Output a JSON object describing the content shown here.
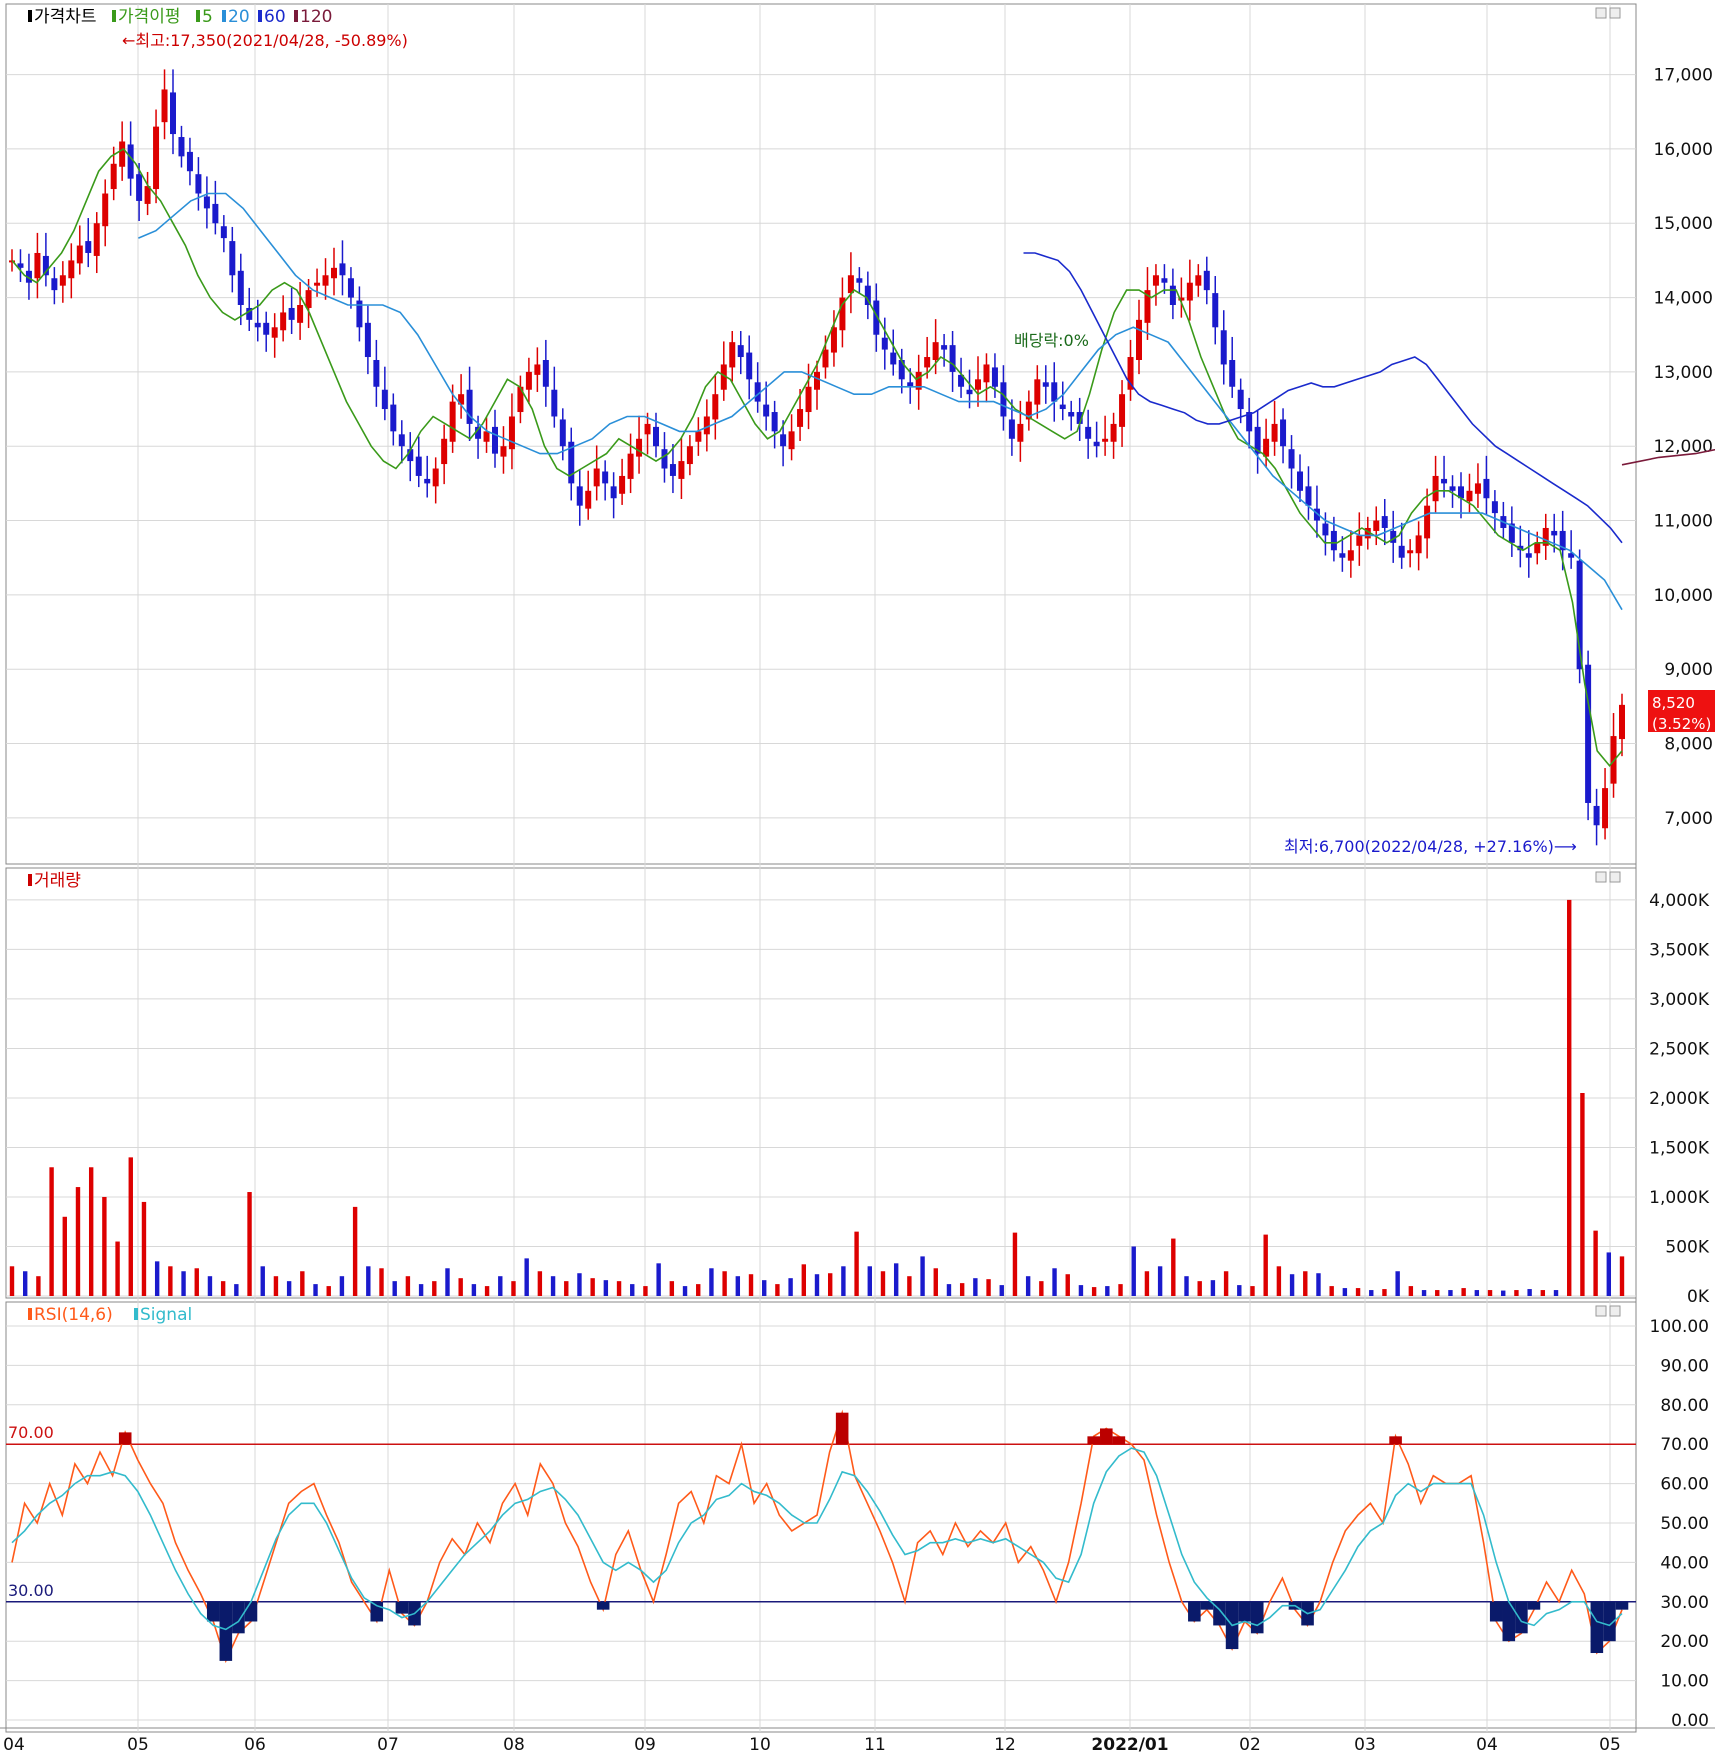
{
  "chart_data": [
    {
      "type": "candlestick",
      "panel": "price",
      "legend": [
        {
          "text": "가격차트",
          "color": "#000000"
        },
        {
          "text": "가격이평",
          "color": "#3a9a1a"
        },
        {
          "text": "5",
          "color": "#3a9a1a"
        },
        {
          "text": "20",
          "color": "#2a8fd8"
        },
        {
          "text": "60",
          "color": "#1a2acc"
        },
        {
          "text": "120",
          "color": "#7a1a3a"
        }
      ],
      "ylim": [
        6500,
        17600
      ],
      "yticks": [
        7000,
        8000,
        9000,
        10000,
        11000,
        12000,
        13000,
        14000,
        15000,
        16000,
        17000
      ],
      "ytick_labels": [
        "7,000",
        "8,000",
        "9,000",
        "10,000",
        "11,000",
        "12,000",
        "13,000",
        "14,000",
        "15,000",
        "16,000",
        "17,000"
      ],
      "annotations": {
        "high": "←최고:17,350(2021/04/28, -50.89%)",
        "low": "최저:6,700(2022/04/28, +27.16%)⟶",
        "dividend": "배당락:0%"
      },
      "last_price_label": "8,520",
      "last_change_label": "(3.52%)",
      "close_series": [
        14500,
        14400,
        14200,
        14600,
        14300,
        14100,
        14300,
        14500,
        14700,
        14600,
        15000,
        15400,
        15800,
        16100,
        15600,
        15300,
        15500,
        16300,
        16800,
        16200,
        15900,
        15700,
        15400,
        15200,
        15000,
        14800,
        14300,
        13900,
        13700,
        13600,
        13500,
        13600,
        13800,
        13700,
        13900,
        14100,
        14200,
        14300,
        14400,
        14300,
        14000,
        13600,
        13200,
        12800,
        12500,
        12200,
        12000,
        11800,
        11600,
        11500,
        11700,
        12100,
        12600,
        12700,
        12300,
        12100,
        12200,
        11900,
        12000,
        12400,
        12800,
        13000,
        13100,
        12800,
        12400,
        12000,
        11500,
        11200,
        11400,
        11700,
        11500,
        11300,
        11600,
        11900,
        12100,
        12300,
        12000,
        11700,
        11600,
        11800,
        12000,
        12200,
        12400,
        12700,
        13100,
        13400,
        13200,
        12900,
        12600,
        12400,
        12200,
        12000,
        12200,
        12500,
        12800,
        13000,
        13300,
        13600,
        14000,
        14300,
        14200,
        13900,
        13500,
        13300,
        13100,
        12900,
        12800,
        13000,
        13200,
        13400,
        13300,
        13000,
        12800,
        12700,
        12900,
        13100,
        12800,
        12400,
        12100,
        12300,
        12600,
        12900,
        12800,
        12600,
        12500,
        12400,
        12300,
        12100,
        12000,
        12100,
        12300,
        12700,
        13200,
        13700,
        14100,
        14300,
        14200,
        13900,
        14000,
        14200,
        14300,
        14100,
        13600,
        13100,
        12800,
        12500,
        12200,
        11900,
        12100,
        12300,
        12000,
        11700,
        11400,
        11200,
        11000,
        10800,
        10600,
        10500,
        10600,
        10800,
        10900,
        11000,
        10900,
        10700,
        10500,
        10600,
        10800,
        11200,
        11600,
        11500,
        11400,
        11300,
        11400,
        11500,
        11300,
        11100,
        10900,
        10700,
        10600,
        10500,
        10700,
        10900,
        10800,
        10600,
        10500,
        9000,
        7200,
        6900,
        7400,
        8100,
        8520
      ],
      "ma_series": [
        {
          "name": "5",
          "color": "#3a9a1a",
          "values": [
            14500,
            14300,
            14200,
            14400,
            14600,
            14900,
            15300,
            15700,
            15900,
            16000,
            15800,
            15500,
            15300,
            15000,
            14700,
            14300,
            14000,
            13800,
            13700,
            13800,
            13900,
            14100,
            14200,
            14100,
            13800,
            13400,
            13000,
            12600,
            12300,
            12000,
            11800,
            11700,
            11900,
            12200,
            12400,
            12300,
            12200,
            12100,
            12300,
            12600,
            12900,
            12800,
            12500,
            12000,
            11700,
            11600,
            11700,
            11800,
            11900,
            12100,
            12000,
            11900,
            11800,
            11900,
            12100,
            12400,
            12800,
            13000,
            12900,
            12600,
            12300,
            12100,
            12200,
            12500,
            12800,
            13100,
            13500,
            13900,
            14100,
            14000,
            13700,
            13400,
            13100,
            12900,
            13000,
            13200,
            13100,
            12900,
            12700,
            12800,
            12700,
            12500,
            12400,
            12300,
            12200,
            12100,
            12200,
            12700,
            13300,
            13800,
            14100,
            14100,
            14000,
            14100,
            14100,
            13700,
            13200,
            12800,
            12400,
            12100,
            12000,
            11900,
            11700,
            11400,
            11100,
            10900,
            10700,
            10700,
            10800,
            10900,
            10800,
            10700,
            10800,
            11100,
            11300,
            11400,
            11400,
            11300,
            11200,
            11000,
            10800,
            10700,
            10600,
            10700,
            10700,
            10600,
            9900,
            8800,
            7900,
            7700,
            7900
          ]
        },
        {
          "name": "20",
          "color": "#2a8fd8",
          "values": [
            14800,
            14900,
            15100,
            15300,
            15400,
            15400,
            15200,
            14900,
            14600,
            14300,
            14100,
            14000,
            13900,
            13900,
            13900,
            13800,
            13500,
            13100,
            12700,
            12400,
            12200,
            12100,
            12000,
            11900,
            11900,
            12000,
            12100,
            12300,
            12400,
            12400,
            12300,
            12200,
            12200,
            12300,
            12400,
            12600,
            12800,
            13000,
            13000,
            12900,
            12800,
            12700,
            12700,
            12800,
            12800,
            12800,
            12700,
            12600,
            12600,
            12600,
            12500,
            12400,
            12500,
            12700,
            13000,
            13300,
            13500,
            13600,
            13500,
            13400,
            13100,
            12800,
            12500,
            12200,
            11900,
            11600,
            11400,
            11200,
            11000,
            10900,
            10800,
            10800,
            10900,
            11000,
            11100,
            11100,
            11100,
            11100,
            11000,
            10900,
            10800,
            10700,
            10600,
            10400,
            10200,
            9800
          ]
        },
        {
          "name": "60",
          "color": "#1a2acc",
          "values": [
            14600,
            14600,
            14550,
            14500,
            14350,
            14100,
            13800,
            13500,
            13200,
            12900,
            12700,
            12600,
            12550,
            12500,
            12450,
            12350,
            12300,
            12300,
            12350,
            12400,
            12450,
            12550,
            12650,
            12750,
            12800,
            12850,
            12800,
            12800,
            12850,
            12900,
            12950,
            13000,
            13100,
            13150,
            13200,
            13100,
            12900,
            12700,
            12500,
            12300,
            12150,
            12000,
            11900,
            11800,
            11700,
            11600,
            11500,
            11400,
            11300,
            11200,
            11050,
            10900,
            10700
          ]
        },
        {
          "name": "120",
          "color": "#7a1a3a",
          "values": [
            13800,
            13700,
            13600,
            13500,
            13400,
            13300,
            13200,
            13100,
            13000,
            12900,
            12850,
            12800,
            12750,
            12700,
            12650,
            12600,
            12500,
            12400,
            12350,
            12300,
            12200,
            12100,
            12000,
            11900,
            11850,
            11750
          ]
        }
      ]
    },
    {
      "type": "bar",
      "panel": "volume",
      "legend": [
        {
          "text": "거래량",
          "color": "#cc0000"
        }
      ],
      "ylim": [
        0,
        4100000
      ],
      "yticks": [
        0,
        500000,
        1000000,
        1500000,
        2000000,
        2500000,
        3000000,
        3500000,
        4000000
      ],
      "ytick_labels": [
        "0K",
        "500K",
        "1,000K",
        "1,500K",
        "2,000K",
        "2,500K",
        "3,000K",
        "3,500K",
        "4,000K"
      ],
      "values": [
        300000,
        250000,
        200000,
        1300000,
        800000,
        1100000,
        1300000,
        1000000,
        550000,
        1400000,
        950000,
        350000,
        300000,
        250000,
        280000,
        200000,
        150000,
        120000,
        1050000,
        300000,
        200000,
        150000,
        250000,
        120000,
        100000,
        200000,
        900000,
        300000,
        280000,
        150000,
        200000,
        120000,
        150000,
        280000,
        180000,
        120000,
        100000,
        200000,
        150000,
        380000,
        250000,
        200000,
        150000,
        230000,
        180000,
        160000,
        150000,
        120000,
        100000,
        330000,
        150000,
        100000,
        120000,
        280000,
        250000,
        200000,
        220000,
        160000,
        120000,
        180000,
        320000,
        220000,
        230000,
        300000,
        650000,
        300000,
        250000,
        330000,
        200000,
        400000,
        280000,
        120000,
        130000,
        180000,
        170000,
        110000,
        640000,
        200000,
        150000,
        280000,
        220000,
        110000,
        90000,
        100000,
        120000,
        500000,
        250000,
        300000,
        580000,
        200000,
        150000,
        160000,
        250000,
        110000,
        100000,
        620000,
        300000,
        220000,
        250000,
        230000,
        100000,
        80000,
        80000,
        60000,
        70000,
        250000,
        100000,
        60000,
        60000,
        60000,
        80000,
        60000,
        60000,
        55000,
        60000,
        70000,
        60000,
        60000,
        4000000,
        2050000,
        660000,
        440000,
        400000
      ]
    },
    {
      "type": "line",
      "panel": "rsi",
      "legend": [
        {
          "text": "RSI(14,6)",
          "color": "#ff5a1a"
        },
        {
          "text": "Signal",
          "color": "#33bbcc"
        }
      ],
      "ylim": [
        0,
        100
      ],
      "yticks": [
        0,
        10,
        20,
        30,
        40,
        50,
        60,
        70,
        80,
        90,
        100
      ],
      "ytick_labels": [
        "0.00",
        "10.00",
        "20.00",
        "30.00",
        "40.00",
        "50.00",
        "60.00",
        "70.00",
        "80.00",
        "90.00",
        "100.00"
      ],
      "levels": [
        {
          "value": 70,
          "label": "70.00"
        },
        {
          "value": 30,
          "label": "30.00"
        }
      ],
      "series": [
        {
          "name": "RSI",
          "color": "#ff5a1a",
          "values": [
            40,
            55,
            50,
            60,
            52,
            65,
            60,
            68,
            62,
            73,
            66,
            60,
            55,
            45,
            38,
            32,
            25,
            15,
            22,
            25,
            35,
            45,
            55,
            58,
            60,
            52,
            45,
            35,
            30,
            25,
            38,
            27,
            24,
            30,
            40,
            46,
            42,
            50,
            45,
            55,
            60,
            52,
            65,
            60,
            50,
            44,
            35,
            28,
            42,
            48,
            38,
            30,
            42,
            55,
            58,
            50,
            62,
            60,
            70,
            55,
            60,
            52,
            48,
            50,
            52,
            68,
            78,
            62,
            55,
            48,
            40,
            30,
            45,
            48,
            42,
            50,
            44,
            48,
            45,
            50,
            40,
            44,
            38,
            30,
            40,
            55,
            72,
            74,
            72,
            70,
            66,
            52,
            40,
            30,
            25,
            28,
            24,
            18,
            25,
            22,
            30,
            36,
            28,
            24,
            30,
            40,
            48,
            52,
            55,
            50,
            72,
            65,
            55,
            62,
            60,
            60,
            62,
            45,
            25,
            20,
            22,
            28,
            35,
            30,
            38,
            32,
            17,
            20,
            28
          ]
        },
        {
          "name": "Signal",
          "color": "#33bbcc",
          "values": [
            45,
            48,
            52,
            55,
            57,
            60,
            62,
            62,
            63,
            62,
            58,
            52,
            45,
            38,
            32,
            27,
            24,
            23,
            25,
            30,
            38,
            46,
            52,
            55,
            55,
            50,
            43,
            36,
            31,
            29,
            28,
            26,
            27,
            30,
            34,
            38,
            42,
            45,
            48,
            52,
            55,
            56,
            58,
            59,
            56,
            52,
            46,
            40,
            38,
            40,
            38,
            35,
            38,
            45,
            50,
            52,
            56,
            57,
            60,
            58,
            57,
            55,
            52,
            50,
            50,
            56,
            63,
            62,
            58,
            53,
            47,
            42,
            43,
            45,
            45,
            46,
            45,
            46,
            45,
            46,
            44,
            42,
            40,
            36,
            35,
            42,
            55,
            63,
            67,
            69,
            68,
            62,
            52,
            42,
            35,
            31,
            28,
            24,
            25,
            24,
            26,
            29,
            29,
            27,
            28,
            33,
            38,
            44,
            48,
            50,
            57,
            60,
            58,
            60,
            60,
            60,
            60,
            52,
            40,
            30,
            25,
            24,
            27,
            28,
            30,
            30,
            25,
            24,
            27
          ]
        }
      ]
    }
  ],
  "x_axis": {
    "labels": [
      "04",
      "05",
      "06",
      "07",
      "08",
      "09",
      "10",
      "11",
      "12",
      "2022/01",
      "02",
      "03",
      "04",
      "05"
    ]
  },
  "colors": {
    "up": "#dd0000",
    "down": "#1a1acc",
    "grid": "#d8d8d8",
    "frame": "#888888"
  }
}
